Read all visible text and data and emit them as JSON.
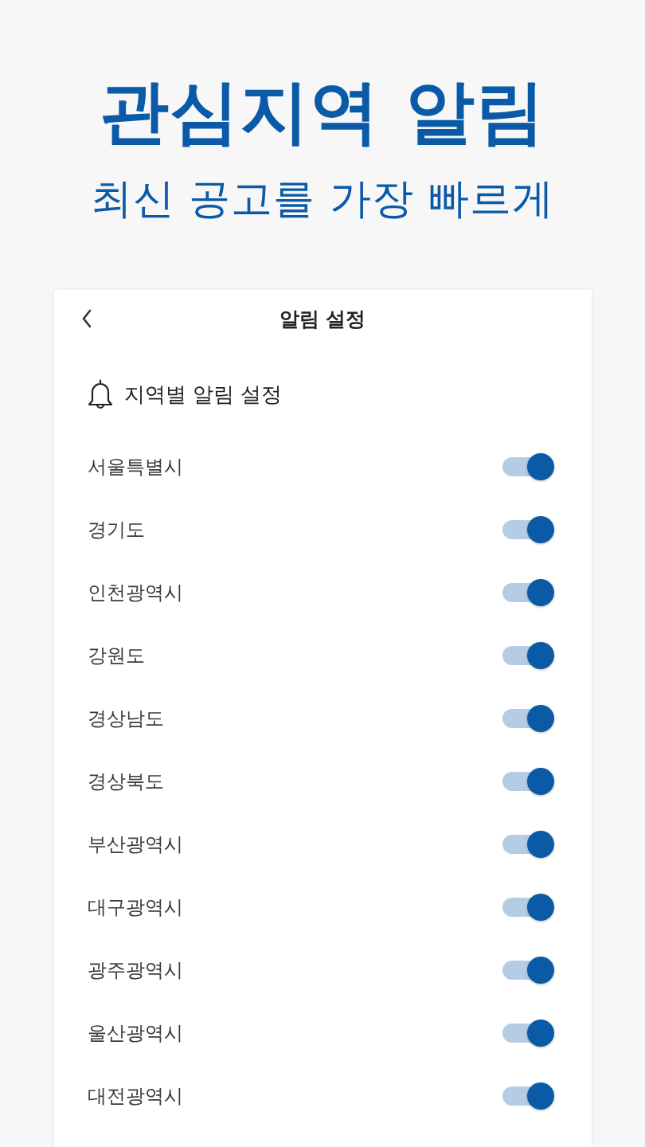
{
  "hero": {
    "title": "관심지역 알림",
    "subtitle": "최신 공고를 가장 빠르게"
  },
  "screen": {
    "title": "알림 설정",
    "section_title": "지역별 알림 설정",
    "regions": [
      {
        "name": "서울특별시",
        "on": true
      },
      {
        "name": "경기도",
        "on": true
      },
      {
        "name": "인천광역시",
        "on": true
      },
      {
        "name": "강원도",
        "on": true
      },
      {
        "name": "경상남도",
        "on": true
      },
      {
        "name": "경상북도",
        "on": true
      },
      {
        "name": "부산광역시",
        "on": true
      },
      {
        "name": "대구광역시",
        "on": true
      },
      {
        "name": "광주광역시",
        "on": true
      },
      {
        "name": "울산광역시",
        "on": true
      },
      {
        "name": "대전광역시",
        "on": true
      }
    ]
  }
}
